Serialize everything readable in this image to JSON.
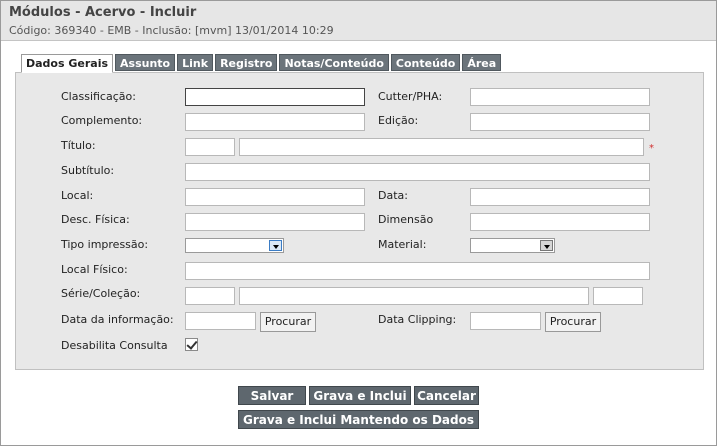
{
  "header": {
    "title": "Módulos - Acervo - Incluir",
    "subtitle": "Código: 369340 - EMB - Inclusão: [mvm] 13/01/2014 10:29"
  },
  "tabs": [
    {
      "label": "Dados Gerais",
      "active": true
    },
    {
      "label": "Assunto"
    },
    {
      "label": "Link"
    },
    {
      "label": "Registro"
    },
    {
      "label": "Notas/Conteúdo"
    },
    {
      "label": "Conteúdo"
    },
    {
      "label": "Área"
    }
  ],
  "form": {
    "classificacao": "Classificação:",
    "cutter": "Cutter/PHA:",
    "complemento": "Complemento:",
    "edicao": "Edição:",
    "titulo": "Título:",
    "required_marker": "*",
    "subtitulo": "Subtítulo:",
    "local": "Local:",
    "data": "Data:",
    "desc_fisica": "Desc. Física:",
    "dimensao": "Dimensão",
    "tipo_impressao": "Tipo impressão:",
    "material": "Material:",
    "local_fisico": "Local Físico:",
    "serie_colecao": "Série/Coleção:",
    "data_informacao": "Data da informação:",
    "procurar_1": "Procurar",
    "data_clipping": "Data Clipping:",
    "procurar_2": "Procurar",
    "desabilita_consulta": "Desabilita Consulta"
  },
  "actions": {
    "salvar": "Salvar",
    "grava_inclui": "Grava e Inclui",
    "cancelar": "Cancelar",
    "grava_inclui_mantendo": "Grava e Inclui Mantendo os Dados"
  }
}
